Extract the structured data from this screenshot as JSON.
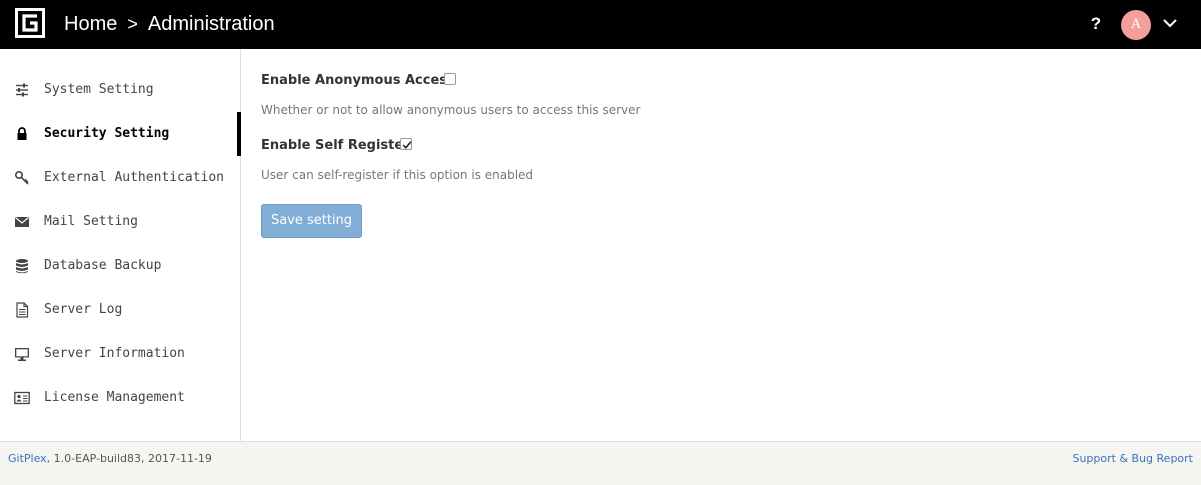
{
  "header": {
    "breadcrumb": [
      "Home",
      "Administration"
    ],
    "separator": ">",
    "help_label": "?",
    "avatar_initial": "A",
    "avatar_color": "#f4a09a"
  },
  "sidebar": {
    "active_index": 1,
    "items": [
      {
        "label": "System Setting",
        "icon": "sliders-icon"
      },
      {
        "label": "Security Setting",
        "icon": "lock-icon"
      },
      {
        "label": "External Authentication",
        "icon": "key-icon"
      },
      {
        "label": "Mail Setting",
        "icon": "envelope-icon"
      },
      {
        "label": "Database Backup",
        "icon": "database-icon"
      },
      {
        "label": "Server Log",
        "icon": "file-icon"
      },
      {
        "label": "Server Information",
        "icon": "monitor-icon"
      },
      {
        "label": "License Management",
        "icon": "id-card-icon"
      }
    ]
  },
  "main": {
    "anonymous": {
      "label": "Enable Anonymous Access",
      "checked": false,
      "help": "Whether or not to allow anonymous users to access this server"
    },
    "self_register": {
      "label": "Enable Self Register",
      "checked": true,
      "help": "User can self-register if this option is enabled"
    },
    "save_label": "Save setting"
  },
  "footer": {
    "product": "GitPlex",
    "version": ", 1.0-EAP-build83, 2017-11-19",
    "support_link": "Support & Bug Report"
  },
  "colors": {
    "topbar": "#000000",
    "accent_button": "#80aed6",
    "link": "#3a72b8"
  }
}
